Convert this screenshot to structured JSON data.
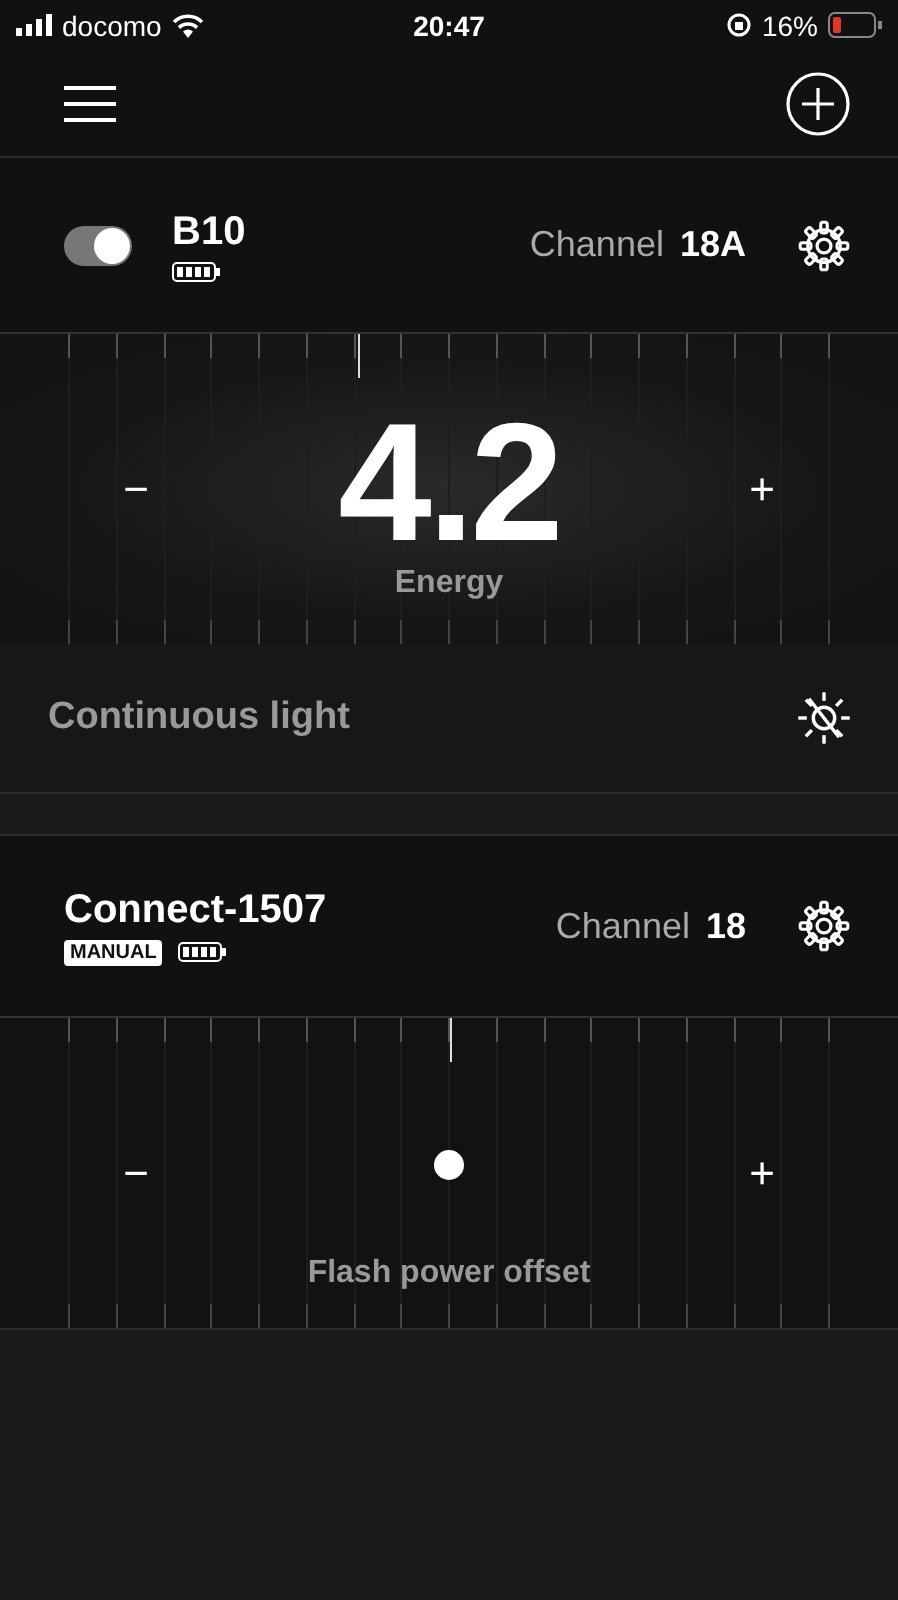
{
  "status_bar": {
    "carrier": "docomo",
    "time": "20:47",
    "battery": "16%"
  },
  "devices": [
    {
      "name": "B10",
      "toggle": {
        "on": true
      },
      "channel_label": "Channel",
      "channel": "18A",
      "dial": {
        "kind": "number",
        "value": "4.2",
        "label": "Energy",
        "level": 0.38,
        "minus": "−",
        "plus": "+"
      },
      "continuous_light": {
        "label": "Continuous light",
        "on": false
      }
    },
    {
      "name": "Connect-1507",
      "badge": "MANUAL",
      "channel_label": "Channel",
      "channel": "18",
      "dial": {
        "kind": "dot",
        "label": "Flash power offset",
        "level": 0.5,
        "minus": "−",
        "plus": "+"
      }
    }
  ]
}
